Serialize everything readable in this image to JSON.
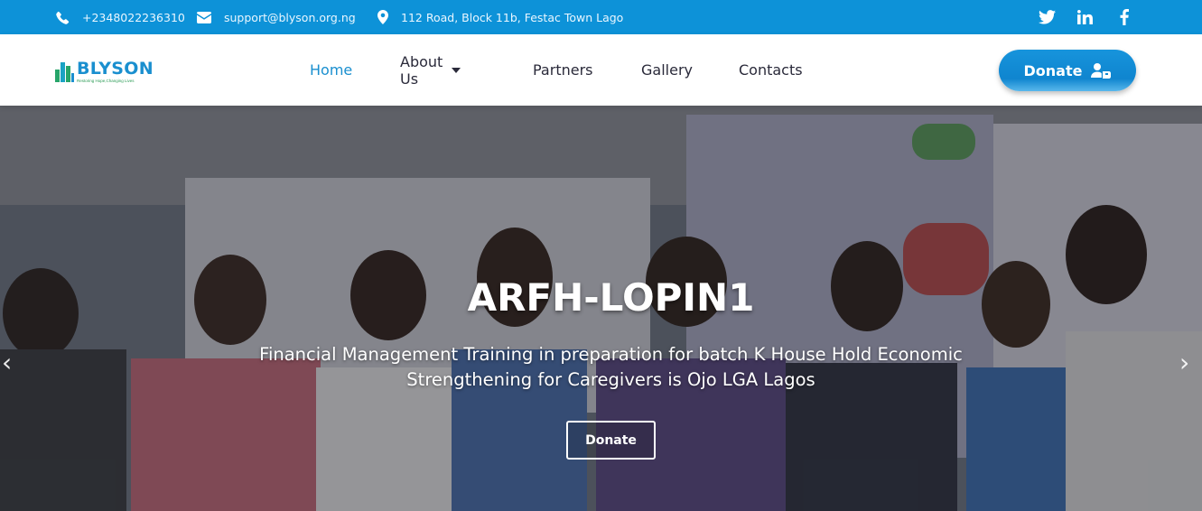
{
  "topbar": {
    "phone": "+2348022236310",
    "email": "support@blyson.org.ng",
    "address": "112 Road, Block 11b, Festac Town Lago",
    "social": [
      "twitter-icon",
      "linkedin-icon",
      "facebook-icon"
    ]
  },
  "brand": {
    "name": "BLYSON",
    "tagline": "Restoring Hope,Changing Lives",
    "colors": {
      "primary": "#0d92d8",
      "logo_green": "#2b9b55"
    }
  },
  "nav": {
    "items": [
      {
        "label": "Home",
        "active": true
      },
      {
        "label": "About Us",
        "dropdown": true
      },
      {
        "label": "Partners"
      },
      {
        "label": "Gallery"
      },
      {
        "label": "Contacts"
      }
    ],
    "donate_label": "Donate"
  },
  "hero": {
    "title": "ARFH-LOPIN1",
    "subtitle": "Financial Management Training in preparation for batch K House Hold Economic Strengthening for Caregivers is Ojo LGA Lagos",
    "button_label": "Donate",
    "prev_icon": "chevron-left-icon",
    "next_icon": "chevron-right-icon"
  }
}
